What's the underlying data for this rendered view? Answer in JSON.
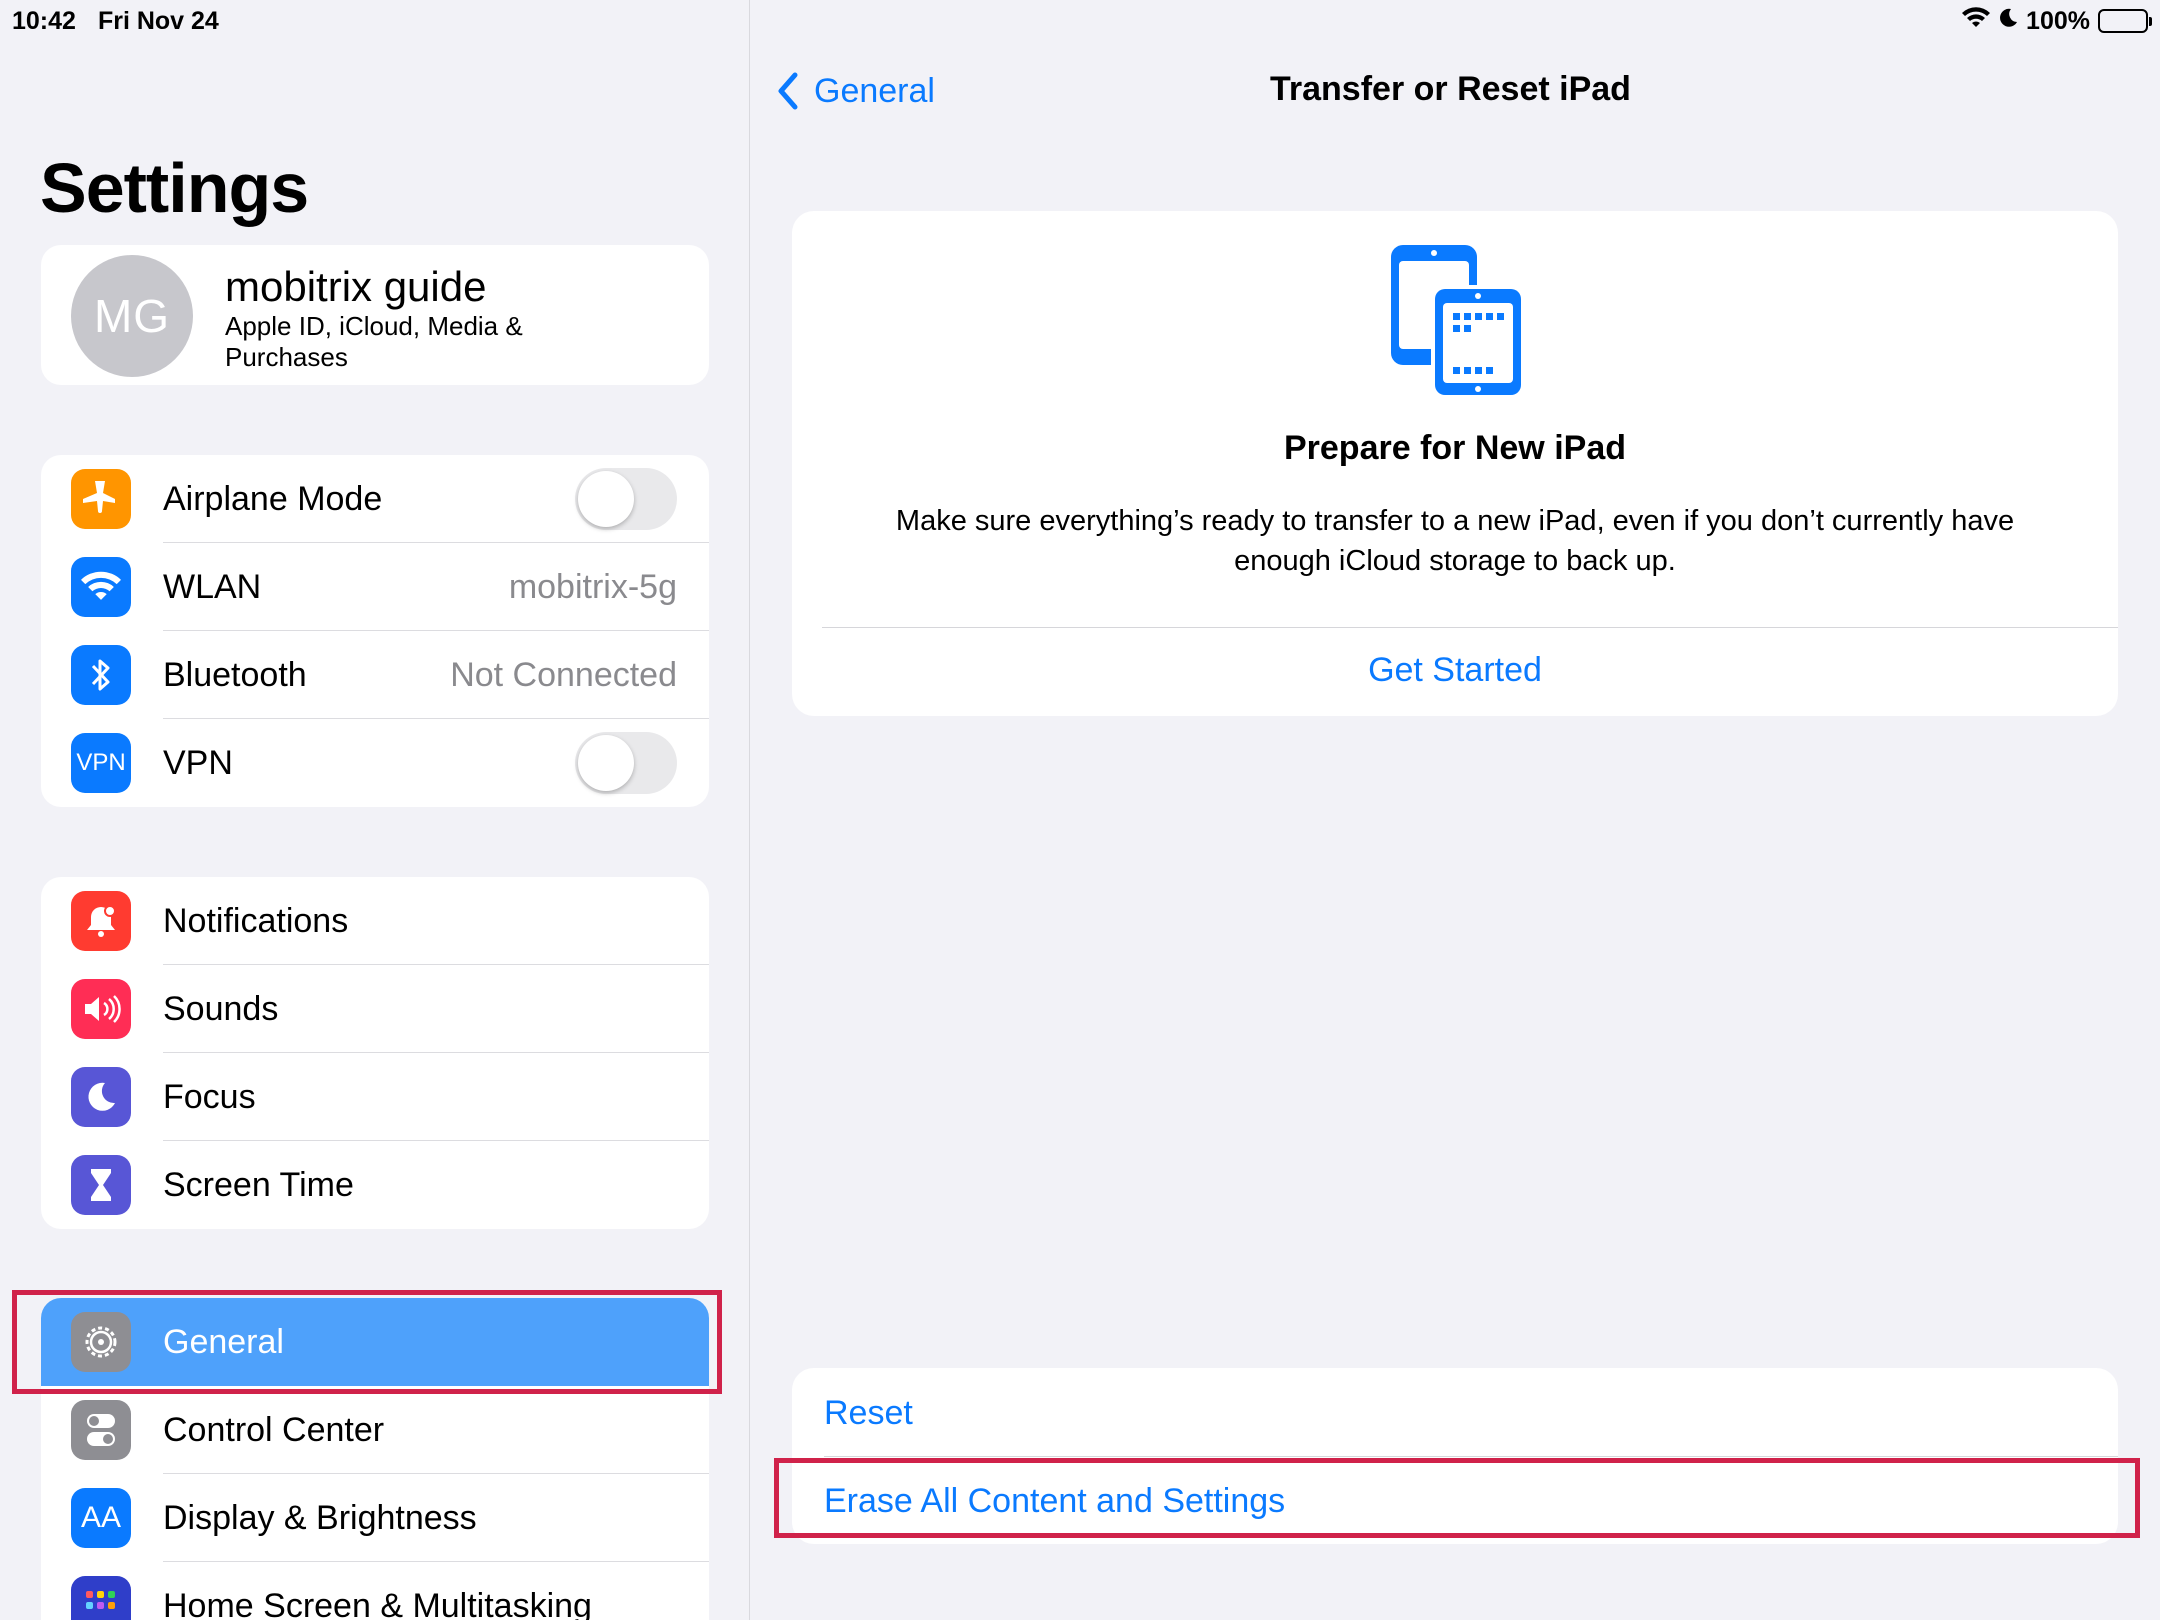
{
  "status_bar": {
    "time": "10:42",
    "date": "Fri Nov 24",
    "battery": "100%"
  },
  "sidebar": {
    "title": "Settings",
    "profile": {
      "initials": "MG",
      "name": "mobitrix guide",
      "subtitle": "Apple ID, iCloud, Media & Purchases"
    },
    "connectivity": [
      {
        "label": "Airplane Mode",
        "icon": "airplane-icon",
        "color": "#ff9500",
        "toggle": false
      },
      {
        "label": "WLAN",
        "icon": "wifi-icon",
        "color": "#0a7aff",
        "value": "mobitrix-5g"
      },
      {
        "label": "Bluetooth",
        "icon": "bluetooth-icon",
        "color": "#0a7aff",
        "value": "Not Connected"
      },
      {
        "label": "VPN",
        "icon": "vpn-icon",
        "color": "#0a7aff",
        "icon_text": "VPN",
        "toggle": false
      }
    ],
    "notifications": [
      {
        "label": "Notifications",
        "icon": "bell-icon",
        "color": "#ff3b30"
      },
      {
        "label": "Sounds",
        "icon": "speaker-icon",
        "color": "#ff2d55"
      },
      {
        "label": "Focus",
        "icon": "moon-icon",
        "color": "#5856d6"
      },
      {
        "label": "Screen Time",
        "icon": "hourglass-icon",
        "color": "#5856d6"
      }
    ],
    "general": [
      {
        "label": "General",
        "icon": "gear-icon",
        "color": "#8e8e93",
        "selected": true
      },
      {
        "label": "Control Center",
        "icon": "toggles-icon",
        "color": "#8e8e93"
      },
      {
        "label": "Display & Brightness",
        "icon": "text-size-icon",
        "color": "#0a7aff",
        "icon_text": "AA"
      },
      {
        "label": "Home Screen & Multitasking",
        "icon": "home-grid-icon",
        "color": "#2f3ec9"
      }
    ]
  },
  "detail": {
    "back_label": "General",
    "title": "Transfer or Reset iPad",
    "prepare": {
      "icon": "ipad-transfer-icon",
      "title": "Prepare for New iPad",
      "body": "Make sure everything’s ready to transfer to a new iPad, even if you don’t currently have enough iCloud storage to back up.",
      "action": "Get Started"
    },
    "reset_label": "Reset",
    "erase_label": "Erase All Content and Settings"
  },
  "colors": {
    "accent": "#0a7aff",
    "selection": "#4ea1fb",
    "highlight": "#d0224a",
    "background": "#f2f2f7"
  }
}
